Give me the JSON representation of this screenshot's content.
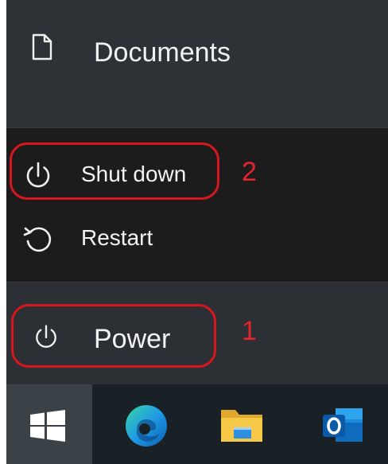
{
  "start_menu": {
    "documents_label": "Documents",
    "power_label": "Power"
  },
  "power_flyout": {
    "items": [
      {
        "label": "Shut down",
        "icon": "power-icon"
      },
      {
        "label": "Restart",
        "icon": "restart-icon"
      }
    ]
  },
  "annotations": {
    "step_1": "1",
    "step_2": "2",
    "highlight_color": "#d8161d"
  },
  "taskbar": {
    "items": [
      {
        "name": "start",
        "icon": "windows-logo-icon"
      },
      {
        "name": "edge",
        "icon": "edge-icon"
      },
      {
        "name": "file-explorer",
        "icon": "folder-icon"
      },
      {
        "name": "outlook",
        "icon": "outlook-icon"
      }
    ]
  },
  "colors": {
    "menu_background": "#2c3034",
    "flyout_background": "#1c1c1c",
    "taskbar_background": "#1a2126",
    "text": "#f3f3f3"
  }
}
